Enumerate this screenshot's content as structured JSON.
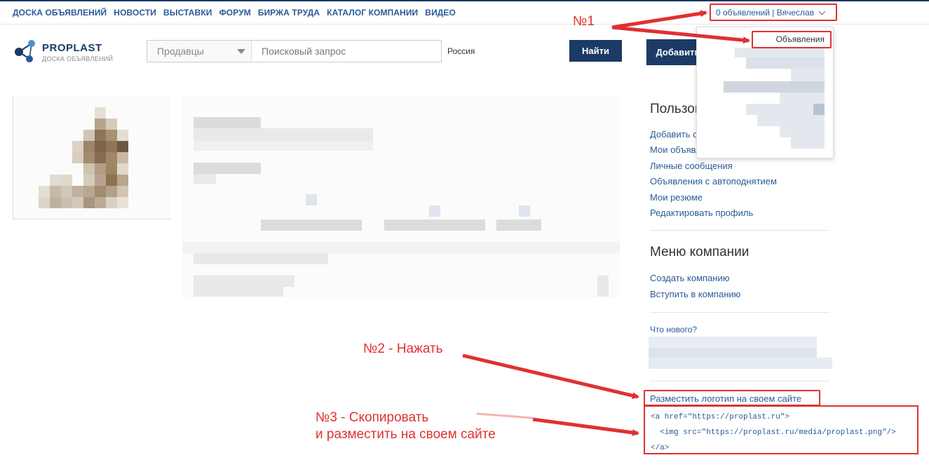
{
  "nav": {
    "items": [
      "ДОСКА ОБЪЯВЛЕНИЙ",
      "НОВОСТИ",
      "ВЫСТАВКИ",
      "ФОРУМ",
      "БИРЖА ТРУДА",
      "КАТАЛОГ КОМПАНИИ",
      "ВИДЕО"
    ]
  },
  "user_menu": {
    "label": "0 объявлений | Вячеслав",
    "icon": "chevron-down-icon"
  },
  "logo": {
    "title": "PROPLAST",
    "subtitle": "ДОСКА ОБЪЯВЛЕНИЙ",
    "icon": "molecule-logo-icon"
  },
  "search": {
    "category_value": "Продавцы",
    "query_placeholder": "Поисковый запрос",
    "region_value": "Россия",
    "submit_label": "Найти"
  },
  "add_button": {
    "label": "Добавить"
  },
  "dropdown": {
    "item": "Объявления"
  },
  "sidebar": {
    "user_menu_title": "Пользователь",
    "user_links": [
      "Добавить объявление",
      "Мои объявления",
      "Личные сообщения",
      "Объявления с автоподнятием",
      "Мои резюме",
      "Редактировать профиль"
    ],
    "company_title": "Меню компании",
    "company_links": [
      "Создать компанию",
      "Вступить в компанию"
    ],
    "whats_new": "Что нового?",
    "logo_link": "Разместить логотип на своем сайте",
    "code_lines": [
      "<a href=\"https://proplast.ru\">",
      "  <img src=\"https://proplast.ru/media/proplast.png\"/>",
      "</a>"
    ]
  },
  "annotations": {
    "step1": "№1",
    "step2": "№2 - Нажать",
    "step3_line1": "№3 - Скопировать",
    "step3_line2": "и разместить на своем сайте",
    "color": "#e03131"
  },
  "colors": {
    "brand": "#1b3a66",
    "link": "#2a5a96"
  }
}
